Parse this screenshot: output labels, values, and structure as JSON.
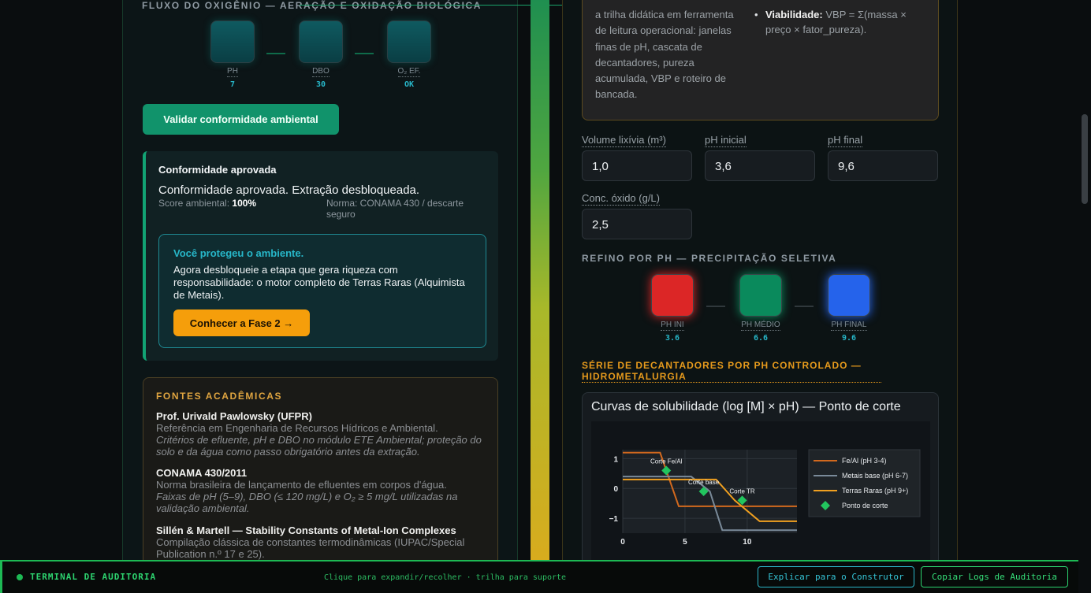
{
  "left": {
    "oxygen_title": "FLUXO DO OXIGÊNIO — AERAÇÃO E OXIDAÇÃO BIOLÓGICA",
    "gauges": [
      {
        "label": "PH",
        "value": "7"
      },
      {
        "label": "DBO",
        "value": "30"
      },
      {
        "label": "O₂ EF.",
        "value": "OK"
      }
    ],
    "validate_button": "Validar conformidade ambiental",
    "compliance": {
      "heading": "Conformidade aprovada",
      "message": "Conformidade aprovada. Extração desbloqueada.",
      "score_label": "Score ambiental:",
      "score_value": "100%",
      "norm": "Norma: CONAMA 430 / descarte seguro",
      "protect_title": "Você protegeu o ambiente.",
      "protect_text": "Agora desbloqueie a etapa que gera riqueza com responsabilidade: o motor completo de Terras Raras (Alquimista de Metais).",
      "phase_button": "Conhecer a Fase 2 →"
    },
    "sources": {
      "title": "FONTES ACADÊMICAS",
      "items": [
        {
          "name": "Prof. Urivald Pawlowsky (UFPR)",
          "desc": "Referência em Engenharia de Recursos Hídricos e Ambiental.",
          "note": "Critérios de efluente, pH e DBO no módulo ETE Ambiental; proteção do solo e da água como passo obrigatório antes da extração."
        },
        {
          "name": "CONAMA 430/2011",
          "desc": "Norma brasileira de lançamento de efluentes em corpos d'água.",
          "note": "Faixas de pH (5–9), DBO (≤ 120 mg/L) e O₂ ≥ 5 mg/L utilizadas na validação ambiental."
        },
        {
          "name": "Sillén & Martell — Stability Constants of Metal-Ion Complexes",
          "desc": "Compilação clássica de constantes termodinâmicas (IUPAC/Special Publication n.º 17 e 25).",
          "note": ""
        }
      ]
    }
  },
  "right": {
    "info_text": "a trilha didática em ferramenta de leitura operacional: janelas finas de pH, cascata de decantadores, pureza acumulada, VBP e roteiro de bancada.",
    "info_bullet_label": "Viabilidade:",
    "info_bullet_text": "VBP = Σ(massa × preço × fator_pureza).",
    "fields": [
      {
        "label": "Volume lixívia (m³)",
        "value": "1,0"
      },
      {
        "label": "pH inicial",
        "value": "3,6"
      },
      {
        "label": "pH final",
        "value": "9,6"
      },
      {
        "label": "Conc. óxido (g/L)",
        "value": "2,5"
      }
    ],
    "ph_title": "REFINO POR PH — PRECIPITAÇÃO SELETIVA",
    "ph_gauges": [
      {
        "label": "PH INI",
        "value": "3.6",
        "color": "#dc2626"
      },
      {
        "label": "PH MÉDIO",
        "value": "6.6",
        "color": "#0a8a5c"
      },
      {
        "label": "PH FINAL",
        "value": "9.6",
        "color": "#2563eb"
      }
    ],
    "decanter_title": "SÉRIE DE DECANTADORES POR PH CONTROLADO — HIDROMETALURGIA",
    "chart_title": "Curvas de solubilidade (log [M] × pH) — Ponto de corte"
  },
  "chart_data": {
    "type": "line",
    "title": "Curvas de solubilidade (log [M] × pH) — Ponto de corte",
    "xlabel": "",
    "ylabel": "",
    "xlim": [
      0,
      14
    ],
    "ylim": [
      -1.5,
      1.3
    ],
    "xticks": [
      "0",
      "5",
      "10"
    ],
    "yticks": [
      "1",
      "0",
      "−1"
    ],
    "series": [
      {
        "name": "Fe/Al (pH 3-4)",
        "color": "#d2691e",
        "points": [
          [
            0,
            1.2
          ],
          [
            3,
            1.2
          ],
          [
            4.5,
            -0.6
          ],
          [
            14,
            -0.6
          ]
        ]
      },
      {
        "name": "Metais base (pH 6-7)",
        "color": "#7a8a99",
        "points": [
          [
            0,
            0.4
          ],
          [
            5.5,
            0.4
          ],
          [
            7,
            -0.1
          ],
          [
            8,
            -1.4
          ],
          [
            14,
            -1.4
          ]
        ]
      },
      {
        "name": "Terras Raras (pH 9+)",
        "color": "#f0a020",
        "points": [
          [
            0,
            0.3
          ],
          [
            7.5,
            0.3
          ],
          [
            9,
            -0.4
          ],
          [
            11,
            -1.1
          ],
          [
            14,
            -1.1
          ]
        ]
      }
    ],
    "cut_points": {
      "name": "Ponto de corte",
      "color": "#22c55e",
      "points": [
        {
          "x": 3.5,
          "y": 0.6,
          "label": "Corte Fe/Al"
        },
        {
          "x": 6.5,
          "y": -0.1,
          "label": "Corte base"
        },
        {
          "x": 9.6,
          "y": -0.4,
          "label": "Corte TR"
        }
      ]
    },
    "legend": "right",
    "grid": true
  },
  "terminal": {
    "title": "TERMINAL DE AUDITORIA",
    "hint": "Clique para expandir/recolher · trilha para suporte",
    "explain_button": "Explicar para o Construtor",
    "copy_button": "Copiar Logs de Auditoria"
  }
}
